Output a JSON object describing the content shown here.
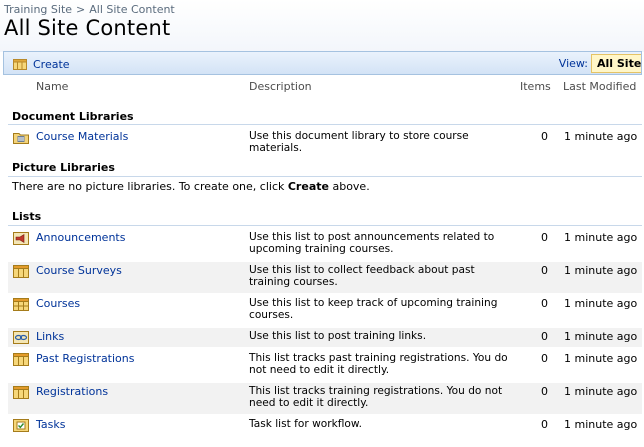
{
  "breadcrumb": {
    "site": "Training Site",
    "separator": ">",
    "current": "All Site Content"
  },
  "page": {
    "title": "All Site Content"
  },
  "toolbar": {
    "create_label": "Create",
    "view_label": "View:",
    "view_value": "All Site Content"
  },
  "columns": {
    "name": "Name",
    "description": "Description",
    "items": "Items",
    "modified": "Last Modified"
  },
  "sections": {
    "doc_libraries": {
      "title": "Document Libraries",
      "items": [
        {
          "name": "Course Materials",
          "description": "Use this document library to store course materials.",
          "count": "0",
          "modified": "1 minute ago",
          "icon": "document-library-icon"
        }
      ]
    },
    "picture_libraries": {
      "title": "Picture Libraries",
      "empty_before": "There are no picture libraries. To create one, click ",
      "empty_link": "Create",
      "empty_after": " above."
    },
    "lists": {
      "title": "Lists",
      "items": [
        {
          "name": "Announcements",
          "description": "Use this list to post announcements related to upcoming training courses.",
          "count": "0",
          "modified": "1 minute ago",
          "icon": "announcements-icon"
        },
        {
          "name": "Course Surveys",
          "description": "Use this list to collect feedback about past training courses.",
          "count": "0",
          "modified": "1 minute ago",
          "icon": "list-icon"
        },
        {
          "name": "Courses",
          "description": "Use this list to keep track of upcoming training courses.",
          "count": "0",
          "modified": "1 minute ago",
          "icon": "calendar-list-icon"
        },
        {
          "name": "Links",
          "description": "Use this list to post training links.",
          "count": "0",
          "modified": "1 minute ago",
          "icon": "links-icon"
        },
        {
          "name": "Past Registrations",
          "description": "This list tracks past training registrations. You do not need to edit it directly.",
          "count": "0",
          "modified": "1 minute ago",
          "icon": "list-icon"
        },
        {
          "name": "Registrations",
          "description": "This list tracks training registrations. You do not need to edit it directly.",
          "count": "0",
          "modified": "1 minute ago",
          "icon": "list-icon"
        },
        {
          "name": "Tasks",
          "description": "Task list for workflow.",
          "count": "0",
          "modified": "1 minute ago",
          "icon": "tasks-icon"
        }
      ]
    }
  }
}
